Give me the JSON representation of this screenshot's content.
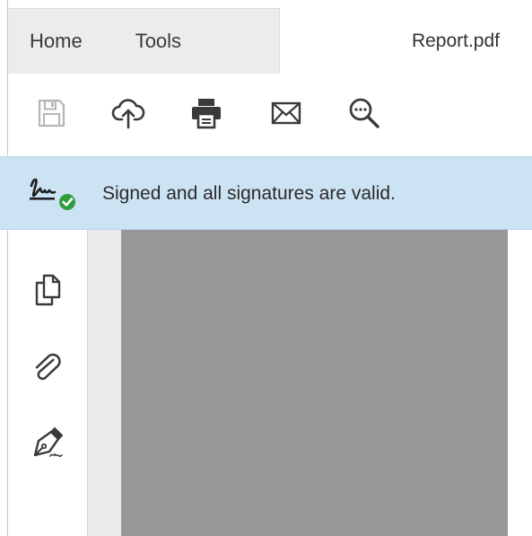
{
  "tabs": {
    "home_label": "Home",
    "tools_label": "Tools",
    "document_label": "Report.pdf"
  },
  "toolbar": {
    "icons": [
      "save-icon",
      "cloud-upload-icon",
      "print-icon",
      "email-icon",
      "zoom-icon"
    ],
    "save_enabled": false
  },
  "signature_banner": {
    "message": "Signed and all signatures are valid.",
    "status_color": "#2e9e3f"
  },
  "side_rail": {
    "icons": [
      "page-thumbnails-icon",
      "attachments-icon",
      "signatures-icon"
    ]
  },
  "colors": {
    "banner_bg": "#cce3f4",
    "page_gray": "#979797",
    "tab_bg": "#ececec"
  }
}
